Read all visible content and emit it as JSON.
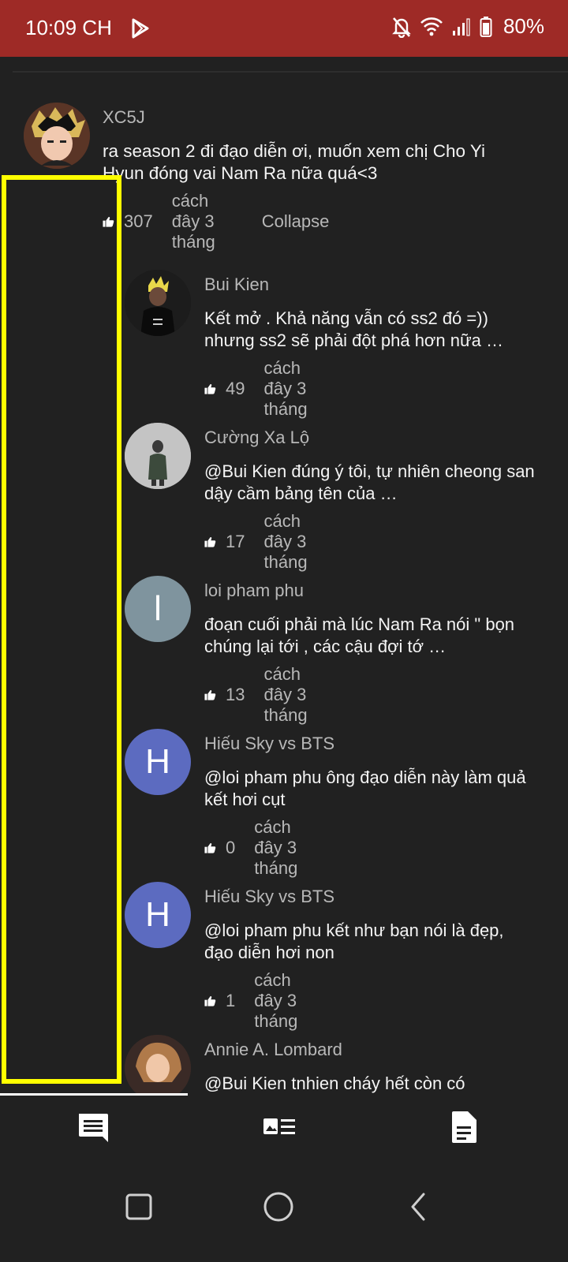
{
  "status_bar": {
    "time": "10:09 CH",
    "battery": "80%",
    "icons": [
      "play-store-icon",
      "bell-off-icon",
      "wifi-icon",
      "signal-icon",
      "battery-icon"
    ]
  },
  "main_comment": {
    "author": "XC5J",
    "text": "ra season 2 đi đạo diễn ơi, muốn xem chị Cho Yi Hyun đóng vai Nam Ra nữa quá<3",
    "likes": "307",
    "time": "cách đây 3 tháng",
    "collapse_label": "Collapse"
  },
  "replies": [
    {
      "author": "Bui Kien",
      "text": "Kết mở . Khả năng vẫn có ss2 đó =)) nhưng ss2 sẽ phải đột phá hơn nữa …",
      "likes": "49",
      "time": "cách đây 3 tháng",
      "avatar_letter": "",
      "avatar_color": "#151515"
    },
    {
      "author": "Cường Xa Lộ",
      "text": " @Bui Kien  đúng ý tôi, tự nhiên cheong san dậy cầm bảng tên của …",
      "likes": "17",
      "time": "cách đây 3 tháng",
      "avatar_letter": "",
      "avatar_color": "#bdbdbd"
    },
    {
      "author": "loi pham phu",
      "text": "đoạn cuối phải mà lúc Nam Ra nói \" bọn chúng lại tới , các cậu đợi tớ …",
      "likes": "13",
      "time": "cách đây 3 tháng",
      "avatar_letter": "l",
      "avatar_color": "#7f949e"
    },
    {
      "author": "Hiếu Sky vs BTS",
      "text": " @loi pham phu  ông đạo diễn này làm quả kết hơi cụt",
      "likes": "0",
      "time": "cách đây 3 tháng",
      "avatar_letter": "H",
      "avatar_color": "#5c6bc0"
    },
    {
      "author": "Hiếu Sky vs BTS",
      "text": " @loi pham phu  kết như bạn nói là đẹp, đạo diễn hơi non",
      "likes": "1",
      "time": "cách đây 3 tháng",
      "avatar_letter": "H",
      "avatar_color": "#5c6bc0"
    },
    {
      "author": "Annie A. Lombard",
      "text": " @Bui Kien  tnhien cháy hết còn có",
      "likes": "",
      "time": "",
      "avatar_letter": "",
      "avatar_color": "#3a2a26"
    }
  ],
  "tabs": [
    "comments-icon",
    "related-videos-icon",
    "description-icon"
  ],
  "nav": [
    "recents-icon",
    "home-icon",
    "back-icon"
  ],
  "colors": {
    "status_bar": "#9e2a26",
    "background": "#212121",
    "highlight": "#ffff00"
  }
}
